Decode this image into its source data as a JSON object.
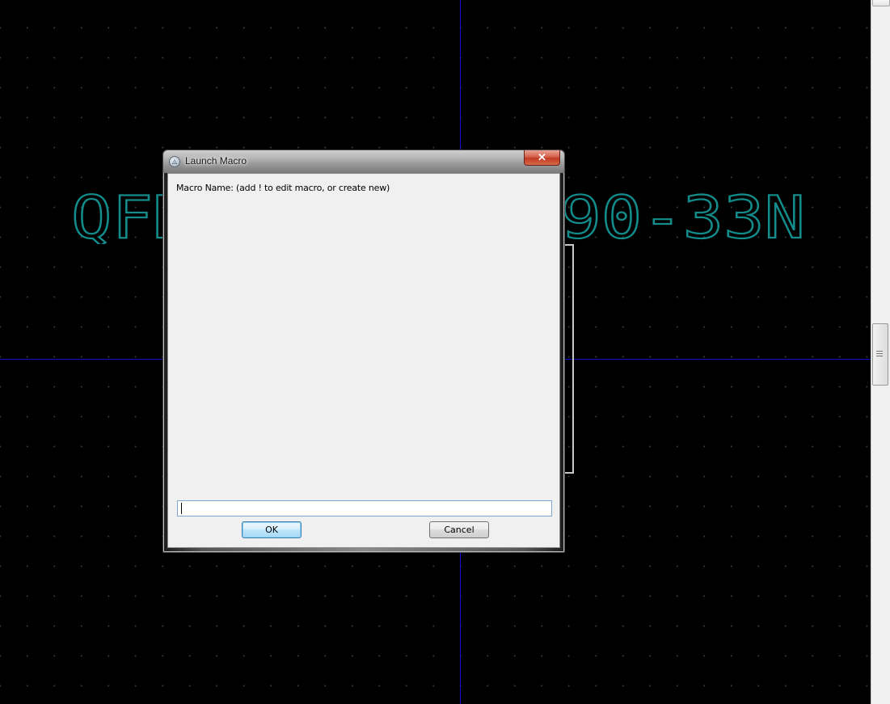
{
  "canvas": {
    "footprint_label": "QFN-10-P1.2X90-33N"
  },
  "dialog": {
    "title": "Launch Macro",
    "close_glyph": "✕",
    "prompt": "Macro Name: (add ! to edit macro, or create new)",
    "input_value": "",
    "ok_label": "OK",
    "cancel_label": "Cancel"
  },
  "icons": {
    "title_icon": "app-icon",
    "close": "close-icon",
    "scrollbar_grip": "grip-icon"
  },
  "colors": {
    "canvas_background": "#000000",
    "grid_dot": "#3a3a3a",
    "axis": "#1010c8",
    "footprint_text": "#138c8c",
    "close_button": "#c33a22"
  }
}
